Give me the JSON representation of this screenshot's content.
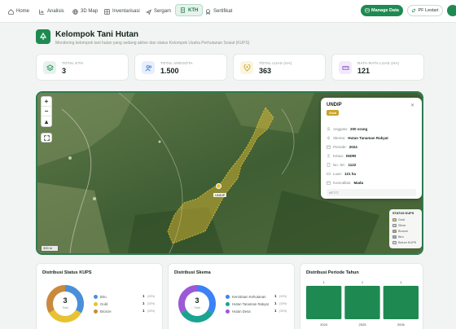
{
  "nav": {
    "items": [
      {
        "label": "Home",
        "icon": "home-icon"
      },
      {
        "label": "Analisis",
        "icon": "chart-icon"
      },
      {
        "label": "3D Map",
        "icon": "globe-icon"
      },
      {
        "label": "Inventarisasi",
        "icon": "grid-icon"
      },
      {
        "label": "Sergam",
        "icon": "plane-icon"
      },
      {
        "label": "KTH",
        "icon": "document-icon"
      },
      {
        "label": "Sertifikat",
        "icon": "award-icon"
      }
    ],
    "manage_label": "Manage Data",
    "pf_label": "PF Lestari"
  },
  "header": {
    "title": "Kelompok Tani Hutan",
    "subtitle": "Monitoring kelompok tani hutan yang sedang aktive dan status Kelompok Usaha Perhutanan Sosial (KUPS)"
  },
  "stats": [
    {
      "label": "TOTAL KTH",
      "value": "3"
    },
    {
      "label": "TOTAL ANGGOTA",
      "value": "1.500"
    },
    {
      "label": "TOTAL LUAS (HA)",
      "value": "363"
    },
    {
      "label": "RATA-RATA LUAS (HA)",
      "value": "121"
    }
  ],
  "map": {
    "scale": "300 m",
    "marker_label": "UNDIP",
    "popup": {
      "title": "UNDIP",
      "badge": "Gold",
      "rows": [
        {
          "label": "Anggota:",
          "value": "200 orang"
        },
        {
          "label": "Skema:",
          "value": "Hutan Tanaman Rakyat"
        },
        {
          "label": "Periode:",
          "value": "2024"
        },
        {
          "label": "Ketua:",
          "value": "INDRI"
        },
        {
          "label": "No. SK:",
          "value": "1122"
        },
        {
          "label": "Luas:",
          "value": "121 ha"
        },
        {
          "label": "Komoditas:",
          "value": "Madu"
        }
      ],
      "code": "AF777"
    },
    "legend": {
      "title": "STATUS KUPS",
      "items": [
        {
          "label": "Gold",
          "color": "#e8c233"
        },
        {
          "label": "Silver",
          "color": "#c9ccce"
        },
        {
          "label": "Bronze",
          "color": "#d39a5a"
        },
        {
          "label": "Biru",
          "color": "#7fb0e0"
        },
        {
          "label": "Belum KUPS",
          "color": "#d8d8d8"
        }
      ]
    }
  },
  "cards": {
    "kups": {
      "title": "Distribusi Status KUPS",
      "total": "3",
      "total_label": "Total",
      "items": [
        {
          "label": "Biru",
          "count": "1",
          "pct": "(33%)",
          "color": "#4a90d9"
        },
        {
          "label": "Gold",
          "count": "1",
          "pct": "(33%)",
          "color": "#e8c233"
        },
        {
          "label": "Bronze",
          "count": "1",
          "pct": "(33%)",
          "color": "#c98a3c"
        }
      ]
    },
    "skema": {
      "title": "Distribusi Skema",
      "total": "3",
      "total_label": "Total",
      "items": [
        {
          "label": "Kemitraan Kehutanan",
          "count": "1",
          "pct": "(33%)",
          "color": "#3b82f6"
        },
        {
          "label": "Hutan Tanaman Rakyat",
          "count": "1",
          "pct": "(33%)",
          "color": "#1aa391"
        },
        {
          "label": "Hutan Desa",
          "count": "1",
          "pct": "(33%)",
          "color": "#9b59d6"
        }
      ]
    },
    "periode": {
      "title": "Distribusi Periode Tahun"
    }
  },
  "chart_data": {
    "type": "bar",
    "title": "Distribusi Periode Tahun",
    "categories": [
      "2024",
      "2025",
      "2026"
    ],
    "values": [
      1,
      1,
      1
    ],
    "color": "#1e8a52"
  }
}
